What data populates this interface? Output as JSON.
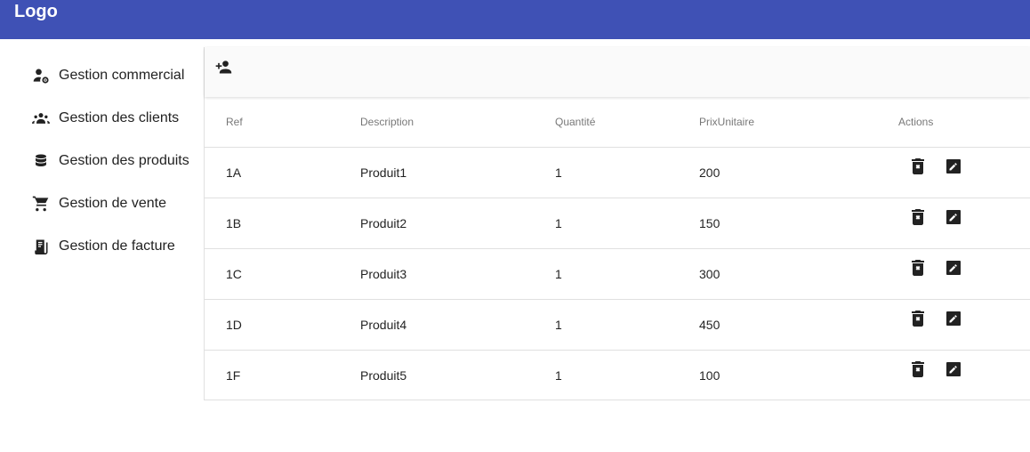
{
  "header": {
    "logo": "Logo",
    "bg_color": "#3f51b5"
  },
  "sidebar": {
    "items": [
      {
        "label": "Gestion commercial",
        "icon": "manage-accounts-icon"
      },
      {
        "label": "Gestion des clients",
        "icon": "groups-icon"
      },
      {
        "label": "Gestion des produits",
        "icon": "database-icon"
      },
      {
        "label": "Gestion de vente",
        "icon": "shopping-cart-icon"
      },
      {
        "label": "Gestion de facture",
        "icon": "receipt-icon"
      }
    ]
  },
  "toolbar": {
    "add_icon": "person-add-icon"
  },
  "table": {
    "headers": [
      "Ref",
      "Description",
      "Quantité",
      "PrixUnitaire",
      "Actions"
    ],
    "rows": [
      [
        "1A",
        "Produit1",
        "1",
        "200"
      ],
      [
        "1B",
        "Produit2",
        "1",
        "150"
      ],
      [
        "1C",
        "Produit3",
        "1",
        "300"
      ],
      [
        "1D",
        "Produit4",
        "1",
        "450"
      ],
      [
        "1F",
        "Produit5",
        "1",
        "100"
      ]
    ],
    "row_actions": [
      "delete-forever-icon",
      "edit-icon"
    ]
  }
}
